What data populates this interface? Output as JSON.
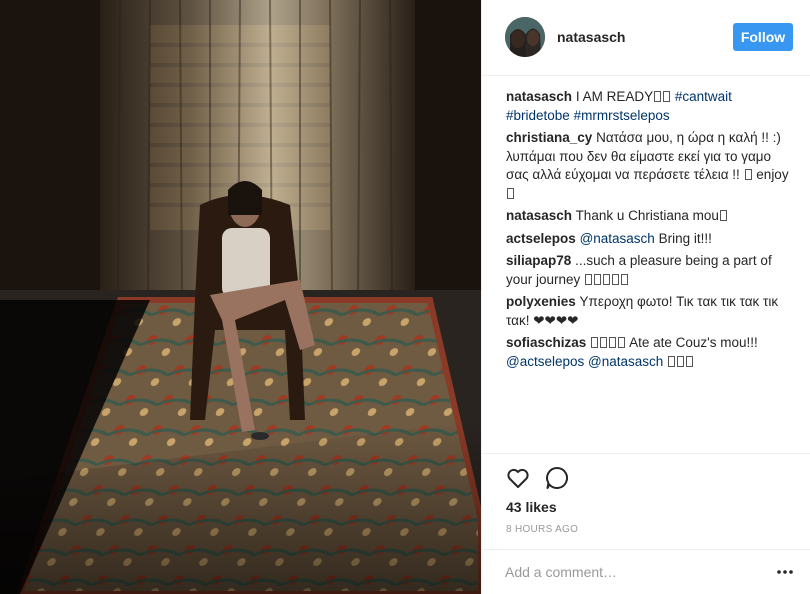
{
  "header": {
    "username": "natasasch",
    "follow_label": "Follow"
  },
  "caption": {
    "user": "natasasch",
    "text": "I AM READY",
    "hashtags": [
      "#cantwait",
      "#bridetobe",
      "#mrmrstselepos"
    ]
  },
  "comments": [
    {
      "user": "christiana_cy",
      "text": "Νατάσα μου, η ώρα η καλή !! :) λυπάμαι που δεν θα είμαστε εκεί για το γαμο σας αλλά εύχομαι να περάσετε τέλεια !!",
      "tail": "enjoy"
    },
    {
      "user": "natasasch",
      "text": "Thank u Christiana mou"
    },
    {
      "user": "actselepos",
      "mention": "@natasasch",
      "text": "Bring it!!!"
    },
    {
      "user": "siliapap78",
      "text": "...such a pleasure being a part of your journey"
    },
    {
      "user": "polyxenies",
      "text": "Υπεροχη φωτο! Τικ τακ τικ τακ τικ τακ! ❤❤❤❤"
    },
    {
      "user": "sofiaschizas",
      "text": "Ate ate Couz's mou!!!",
      "mentions": [
        "@actselepos",
        "@natasasch"
      ]
    }
  ],
  "actions": {
    "like_icon": "heart-icon",
    "comment_icon": "comment-bubble-icon",
    "likes": "43 likes",
    "timestamp": "8 HOURS AGO"
  },
  "add_comment": {
    "placeholder": "Add a comment…",
    "more_icon": "ellipsis-icon"
  },
  "colors": {
    "follow_button": "#3897f0",
    "link": "#003569",
    "muted": "#999999"
  }
}
